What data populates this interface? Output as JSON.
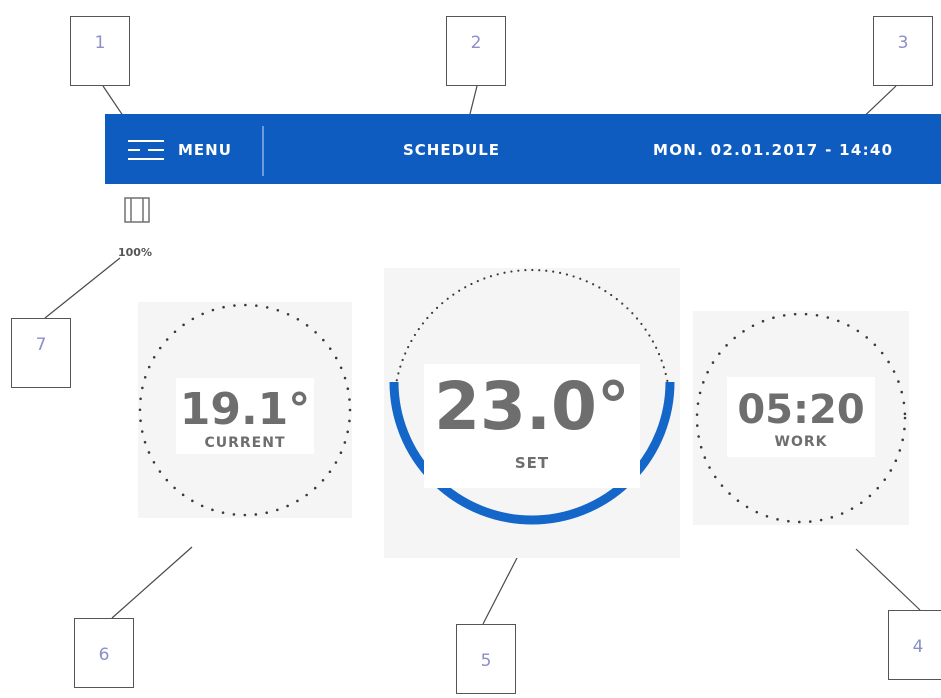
{
  "callouts": [
    "1",
    "2",
    "3",
    "4",
    "5",
    "6",
    "7"
  ],
  "header": {
    "menu_label": "MENU",
    "schedule_label": "SCHEDULE",
    "datetime": "MON. 02.01.2017 - 14:40"
  },
  "window": {
    "icon": "window-icon",
    "open_percent": "100%"
  },
  "current": {
    "value": "19.1°",
    "label": "CURRENT"
  },
  "set": {
    "value": "23.0°",
    "label": "SET"
  },
  "work": {
    "value": "05:20",
    "label": "WORK"
  },
  "colors": {
    "bar": "#0f5cc0",
    "arc": "#1466c8",
    "text": "#6e6e6e",
    "callout_number": "#8a8fc8"
  }
}
